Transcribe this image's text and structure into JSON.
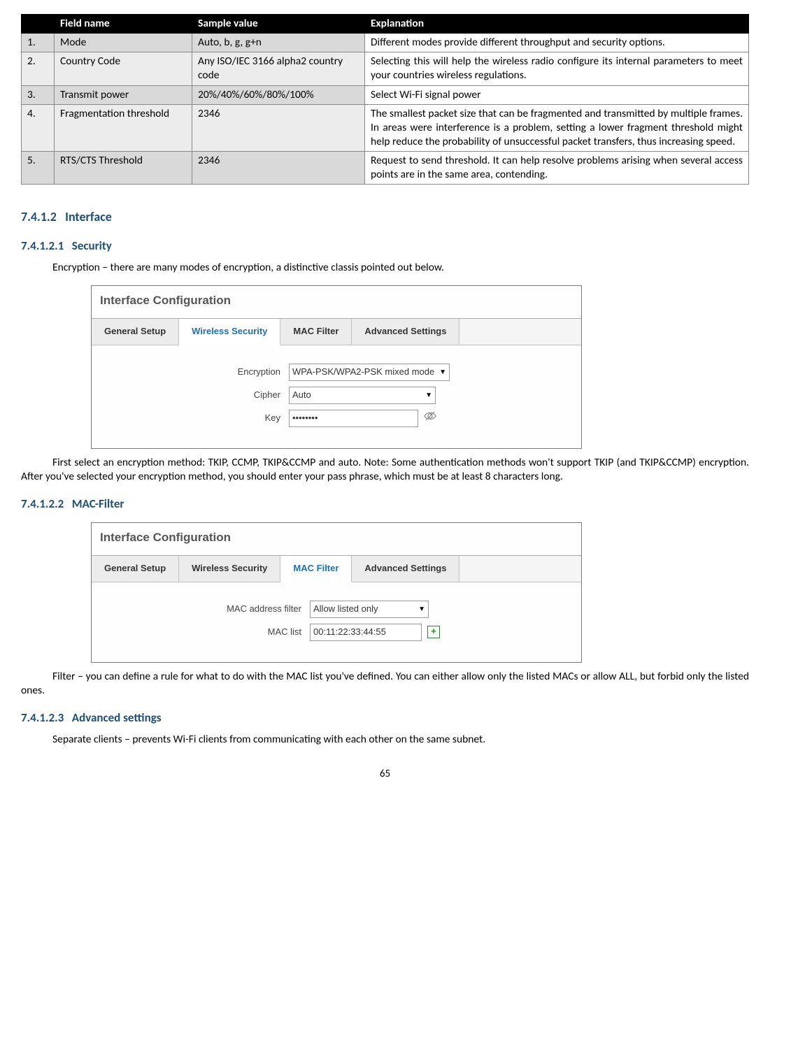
{
  "table": {
    "headers": {
      "num": "",
      "field": "Field name",
      "sample": "Sample value",
      "explain": "Explanation"
    },
    "rows": [
      {
        "num": "1.",
        "field": "Mode",
        "sample": "Auto, b, g, g+n",
        "explain": "Different modes provide different throughput and security options."
      },
      {
        "num": "2.",
        "field": "Country Code",
        "sample": "Any ISO/IEC 3166 alpha2 country code",
        "explain": "Selecting this will help the wireless radio configure its internal parameters to meet your countries wireless regulations."
      },
      {
        "num": "3.",
        "field": "Transmit power",
        "sample": "20%/40%/60%/80%/100%",
        "explain": "Select Wi-Fi signal power"
      },
      {
        "num": "4.",
        "field": "Fragmentation threshold",
        "sample": "2346",
        "explain": "The smallest packet size that can be fragmented and transmitted by multiple frames. In areas were interference is a problem, setting a lower fragment threshold might help reduce the probability of unsuccessful packet transfers, thus increasing speed."
      },
      {
        "num": "5.",
        "field": "RTS/CTS Threshold",
        "sample": "2346",
        "explain": "Request to send threshold. It can help resolve problems arising when several access points are in the same area, contending."
      }
    ]
  },
  "sections": {
    "interface_num": "7.4.1.2",
    "interface_title": "Interface",
    "security_num": "7.4.1.2.1",
    "security_title": "Security",
    "security_body1": "Encryption – there are many modes of encryption, a distinctive classis pointed out below.",
    "security_body2": "First select an encryption method: TKIP, CCMP, TKIP&CCMP and auto. Note: Some authentication methods won't support TKIP (and TKIP&CCMP) encryption.  After you've selected your encryption method, you should enter your pass phrase, which must be at least 8 characters long.",
    "mac_num": "7.4.1.2.2",
    "mac_title": "MAC-Filter",
    "mac_body": "Filter – you can define a rule for what to do with the MAC list you've defined. You can either allow only the listed MACs or allow ALL, but forbid only the listed ones.",
    "adv_num": "7.4.1.2.3",
    "adv_title": "Advanced settings",
    "adv_body": "Separate clients – prevents Wi-Fi clients from communicating with each other on the same subnet."
  },
  "ui1": {
    "title": "Interface Configuration",
    "tabs": {
      "t1": "General Setup",
      "t2": "Wireless Security",
      "t3": "MAC Filter",
      "t4": "Advanced Settings"
    },
    "rows": {
      "encryption_label": "Encryption",
      "encryption_value": "WPA-PSK/WPA2-PSK mixed mode",
      "cipher_label": "Cipher",
      "cipher_value": "Auto",
      "key_label": "Key",
      "key_value": "••••••••"
    }
  },
  "ui2": {
    "title": "Interface Configuration",
    "tabs": {
      "t1": "General Setup",
      "t2": "Wireless Security",
      "t3": "MAC Filter",
      "t4": "Advanced Settings"
    },
    "rows": {
      "filter_label": "MAC address filter",
      "filter_value": "Allow listed only",
      "list_label": "MAC list",
      "list_value": "00:11:22:33:44:55"
    }
  },
  "pagenum": "65"
}
